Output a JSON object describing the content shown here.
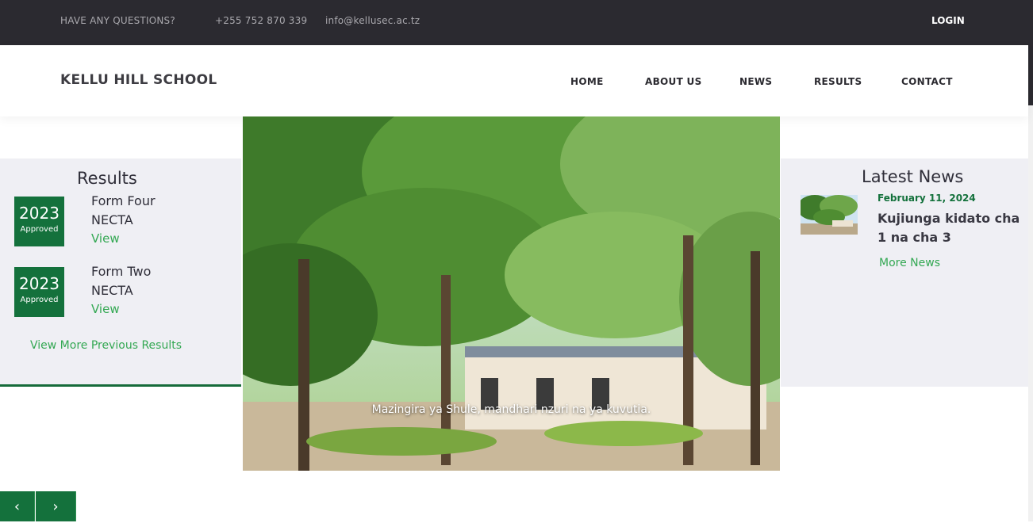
{
  "topbar": {
    "question": "HAVE ANY QUESTIONS?",
    "phone": "+255 752 870 339",
    "email": "info@kellusec.ac.tz",
    "login": "LOGIN"
  },
  "header": {
    "brand": "KELLU HILL SCHOOL",
    "nav": [
      "HOME",
      "ABOUT US",
      "NEWS",
      "RESULTS",
      "CONTACT"
    ]
  },
  "results": {
    "title": "Results",
    "items": [
      {
        "year": "2023",
        "status": "Approved",
        "title": "Form Four NECTA",
        "link": "View"
      },
      {
        "year": "2023",
        "status": "Approved",
        "title": "Form Two NECTA",
        "link": "View"
      }
    ],
    "more": "View More Previous Results"
  },
  "hero": {
    "caption": "Mazingira ya Shule, mandhari nzuri na ya kuvutia."
  },
  "news": {
    "title": "Latest News",
    "items": [
      {
        "date": "February 11, 2024",
        "title": "Kujiunga kidato cha 1 na cha 3"
      }
    ],
    "more": "More News"
  },
  "slider": {
    "prev": "‹",
    "next": "›"
  },
  "colors": {
    "topbar": "#2b2a30",
    "accent_green": "#14713c",
    "link_green": "#34a853",
    "panel_bg": "#efeff4"
  }
}
